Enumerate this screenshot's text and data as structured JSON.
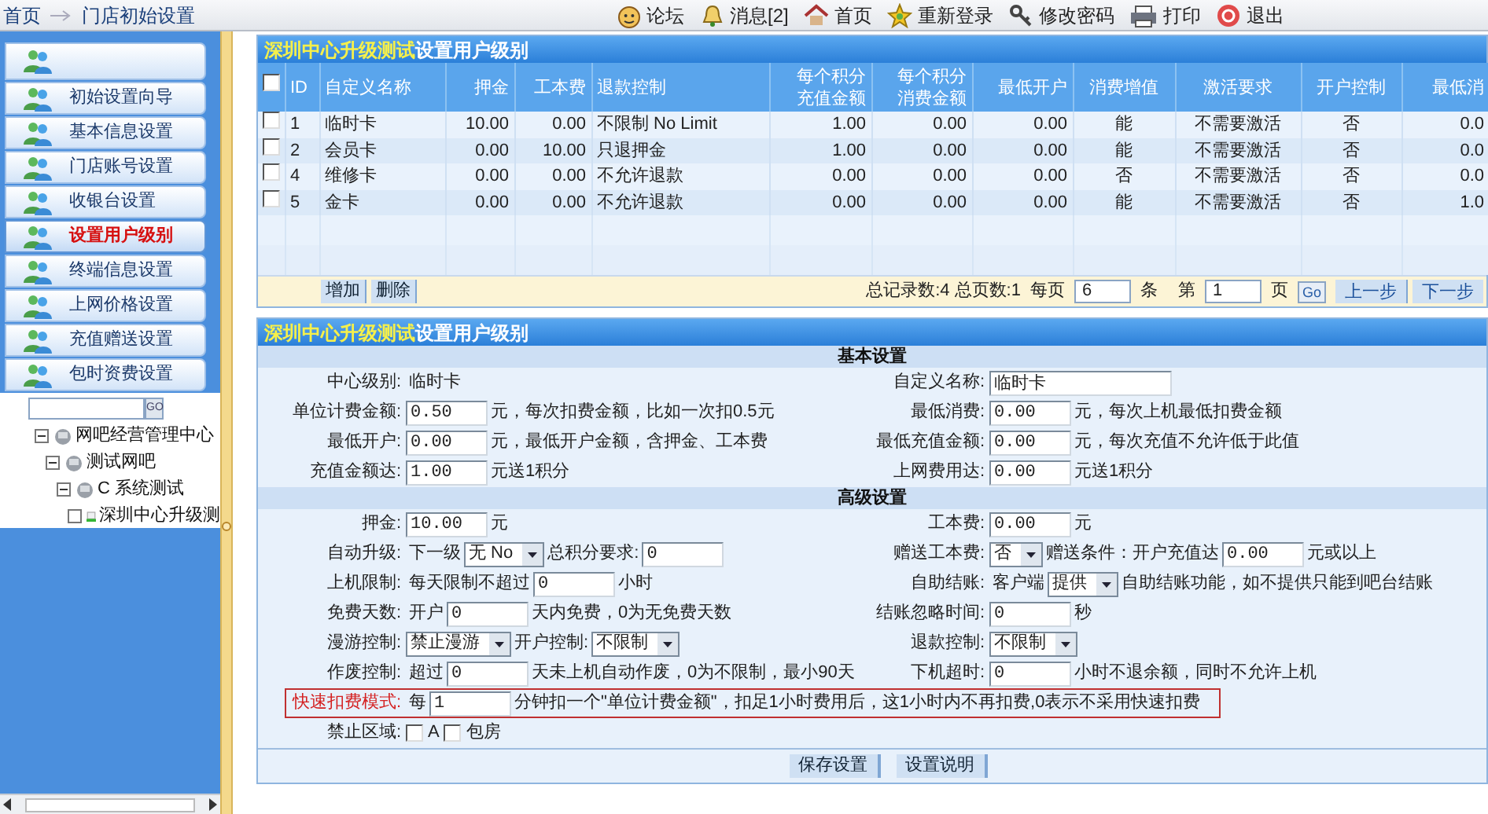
{
  "breadcrumb": [
    {
      "label": "首页"
    },
    {
      "label": "门店初始设置"
    }
  ],
  "toolbar": [
    {
      "label": "论坛"
    },
    {
      "label": "消息[2]"
    },
    {
      "label": "首页"
    },
    {
      "label": "重新登录"
    },
    {
      "label": "修改密码"
    },
    {
      "label": "打印"
    },
    {
      "label": "退出"
    }
  ],
  "sidebar": {
    "items": [
      {
        "selected": false
      },
      {
        "label": "初始设置向导",
        "selected": false
      },
      {
        "label": "基本信息设置",
        "selected": false
      },
      {
        "label": "门店账号设置",
        "selected": false
      },
      {
        "label": "收银台设置",
        "selected": false
      },
      {
        "label": "设置用户级别",
        "selected": true
      },
      {
        "label": "终端信息设置",
        "selected": false
      },
      {
        "label": "上网价格设置",
        "selected": false
      },
      {
        "label": "充值赠送设置",
        "selected": false
      },
      {
        "label": "包时资费设置",
        "selected": false
      }
    ],
    "search_button": "GO",
    "tree": [
      {
        "label": "网吧经营管理中心",
        "expanded": true,
        "children": [
          {
            "label": "测试网吧",
            "expanded": true,
            "children": [
              {
                "label": "C 系统测试",
                "expanded": true,
                "children": [
                  {
                    "label": "深圳中心升级测"
                  }
                ]
              }
            ]
          }
        ]
      }
    ]
  },
  "levels_panel": {
    "title": {
      "center": "深圳中心升级测试",
      "text": "设置用户级别"
    },
    "header_checkbox": {
      "checked": false
    },
    "columns": [
      {
        "label": "ID"
      },
      {
        "label": "自定义名称"
      },
      {
        "label": "押金"
      },
      {
        "label": "工本费"
      },
      {
        "label": "退款控制"
      },
      {
        "label": "每个积分充值金额"
      },
      {
        "label": "每个积分消费金额"
      },
      {
        "label": "最低开户"
      },
      {
        "label": "消费增值"
      },
      {
        "label": "激活要求"
      },
      {
        "label": "开户控制"
      },
      {
        "label": "最低消"
      }
    ],
    "rows": [
      {
        "checked": false,
        "cells": [
          "1",
          "临时卡",
          "10.00",
          "0.00",
          "不限制 No Limit",
          "1.00",
          "0.00",
          "0.00",
          "能",
          "不需要激活",
          "否",
          "0.0"
        ]
      },
      {
        "checked": false,
        "cells": [
          "2",
          "会员卡",
          "0.00",
          "10.00",
          "只退押金",
          "1.00",
          "0.00",
          "0.00",
          "能",
          "不需要激活",
          "否",
          "0.0"
        ]
      },
      {
        "checked": false,
        "cells": [
          "4",
          "维修卡",
          "0.00",
          "0.00",
          "不允许退款",
          "0.00",
          "0.00",
          "0.00",
          "否",
          "不需要激活",
          "否",
          "0.0"
        ]
      },
      {
        "checked": false,
        "cells": [
          "5",
          "金卡",
          "0.00",
          "0.00",
          "不允许退款",
          "0.00",
          "0.00",
          "0.00",
          "能",
          "不需要激活",
          "否",
          "1.0"
        ]
      }
    ],
    "actions": [
      "增加",
      "删除"
    ],
    "pagination": {
      "summary": "总记录数:4 总页数:1",
      "per_page_label": "每页",
      "per_page": "6",
      "per_page_unit": "条",
      "page_label": "第",
      "page": "1",
      "page_unit": "页",
      "go": "Go",
      "prev": "上一步",
      "next": "下一步"
    }
  },
  "settings_panel": {
    "title": {
      "center": "深圳中心升级测试",
      "text": "设置用户级别"
    },
    "sections": [
      {
        "title": "基本设置",
        "rows": [
          {
            "highlighted": false,
            "left": {
              "label": "中心级别:",
              "parts": [
                {
                  "kind": "text",
                  "text": "临时卡"
                }
              ]
            },
            "right": {
              "label": "自定义名称:",
              "parts": [
                {
                  "kind": "long-input",
                  "value": "临时卡"
                }
              ]
            }
          },
          {
            "highlighted": false,
            "left": {
              "label": "单位计费金额:",
              "parts": [
                {
                  "kind": "input",
                  "value": "0.50"
                },
                {
                  "kind": "text",
                  "text": "元，每次扣费金额，比如一次扣0.5元"
                }
              ]
            },
            "right": {
              "label": "最低消费:",
              "parts": [
                {
                  "kind": "input",
                  "value": "0.00"
                },
                {
                  "kind": "text",
                  "text": "元，每次上机最低扣费金额"
                }
              ]
            }
          },
          {
            "highlighted": false,
            "left": {
              "label": "最低开户:",
              "parts": [
                {
                  "kind": "input",
                  "value": "0.00"
                },
                {
                  "kind": "text",
                  "text": "元，最低开户金额，含押金、工本费"
                }
              ]
            },
            "right": {
              "label": "最低充值金额:",
              "parts": [
                {
                  "kind": "input",
                  "value": "0.00"
                },
                {
                  "kind": "text",
                  "text": "元，每次充值不允许低于此值"
                }
              ]
            }
          },
          {
            "highlighted": false,
            "left": {
              "label": "充值金额达:",
              "parts": [
                {
                  "kind": "input",
                  "value": "1.00"
                },
                {
                  "kind": "text",
                  "text": "元送1积分"
                }
              ]
            },
            "right": {
              "label": "上网费用达:",
              "parts": [
                {
                  "kind": "input",
                  "value": "0.00"
                },
                {
                  "kind": "text",
                  "text": "元送1积分"
                }
              ]
            }
          }
        ]
      },
      {
        "title": "高级设置",
        "rows": [
          {
            "highlighted": false,
            "left": {
              "label": "押金:",
              "parts": [
                {
                  "kind": "input",
                  "value": "10.00"
                },
                {
                  "kind": "text",
                  "text": "元"
                }
              ]
            },
            "right": {
              "label": "工本费:",
              "parts": [
                {
                  "kind": "input",
                  "value": "0.00"
                },
                {
                  "kind": "text",
                  "text": "元"
                }
              ]
            }
          },
          {
            "highlighted": false,
            "left": {
              "label": "自动升级:",
              "parts": [
                {
                  "kind": "text",
                  "text": "下一级"
                },
                {
                  "kind": "select",
                  "value": "无 No"
                },
                {
                  "kind": "text",
                  "text": "总积分要求:"
                },
                {
                  "kind": "input",
                  "value": "0"
                }
              ]
            },
            "right": {
              "label": "赠送工本费:",
              "parts": [
                {
                  "kind": "select",
                  "value": "否"
                },
                {
                  "kind": "text",
                  "text": "赠送条件：开户充值达"
                },
                {
                  "kind": "input",
                  "value": "0.00"
                },
                {
                  "kind": "text",
                  "text": "元或以上"
                }
              ]
            }
          },
          {
            "highlighted": false,
            "left": {
              "label": "上机限制:",
              "parts": [
                {
                  "kind": "text",
                  "text": "每天限制不超过"
                },
                {
                  "kind": "input",
                  "value": "0"
                },
                {
                  "kind": "text",
                  "text": "小时"
                }
              ]
            },
            "right": {
              "label": "自助结账:",
              "parts": [
                {
                  "kind": "text",
                  "text": "客户端"
                },
                {
                  "kind": "select",
                  "value": "提供"
                },
                {
                  "kind": "text",
                  "text": "自助结账功能，如不提供只能到吧台结账"
                }
              ]
            }
          },
          {
            "highlighted": false,
            "left": {
              "label": "免费天数:",
              "parts": [
                {
                  "kind": "text",
                  "text": "开户"
                },
                {
                  "kind": "input",
                  "value": "0"
                },
                {
                  "kind": "text",
                  "text": "天内免费，0为无免费天数"
                }
              ]
            },
            "right": {
              "label": "结账忽略时间:",
              "parts": [
                {
                  "kind": "input",
                  "value": "0"
                },
                {
                  "kind": "text",
                  "text": "秒"
                }
              ]
            }
          },
          {
            "highlighted": false,
            "left": {
              "label": "漫游控制:",
              "parts": [
                {
                  "kind": "select",
                  "value": "禁止漫游"
                },
                {
                  "kind": "text",
                  "text": "开户控制:"
                },
                {
                  "kind": "select",
                  "value": "不限制"
                }
              ]
            },
            "right": {
              "label": "退款控制:",
              "parts": [
                {
                  "kind": "select",
                  "value": "不限制"
                }
              ]
            }
          },
          {
            "highlighted": false,
            "left": {
              "label": "作废控制:",
              "parts": [
                {
                  "kind": "text",
                  "text": "超过"
                },
                {
                  "kind": "input",
                  "value": "0"
                },
                {
                  "kind": "text",
                  "text": "天未上机自动作废，0为不限制，最小90天"
                }
              ]
            },
            "right": {
              "label": "下机超时:",
              "parts": [
                {
                  "kind": "input",
                  "value": "0"
                },
                {
                  "kind": "text",
                  "text": "小时不退余额，同时不允许上机"
                }
              ]
            }
          },
          {
            "highlighted": true,
            "left": {
              "label": "快速扣费模式:",
              "parts": [
                {
                  "kind": "text",
                  "text": "每"
                },
                {
                  "kind": "input",
                  "value": "1"
                },
                {
                  "kind": "text",
                  "text": "分钟扣一个\"单位计费金额\"，扣足1小时费用后，这1小时内不再扣费,0表示不采用快速扣费"
                }
              ]
            }
          },
          {
            "highlighted": false,
            "left": {
              "label": "禁止区域:",
              "parts": [
                {
                  "kind": "checkbox",
                  "label": "A",
                  "checked": false
                },
                {
                  "kind": "checkbox",
                  "label": "包房",
                  "checked": false
                }
              ]
            }
          }
        ]
      }
    ],
    "buttons": [
      "保存设置",
      "设置说明"
    ]
  }
}
